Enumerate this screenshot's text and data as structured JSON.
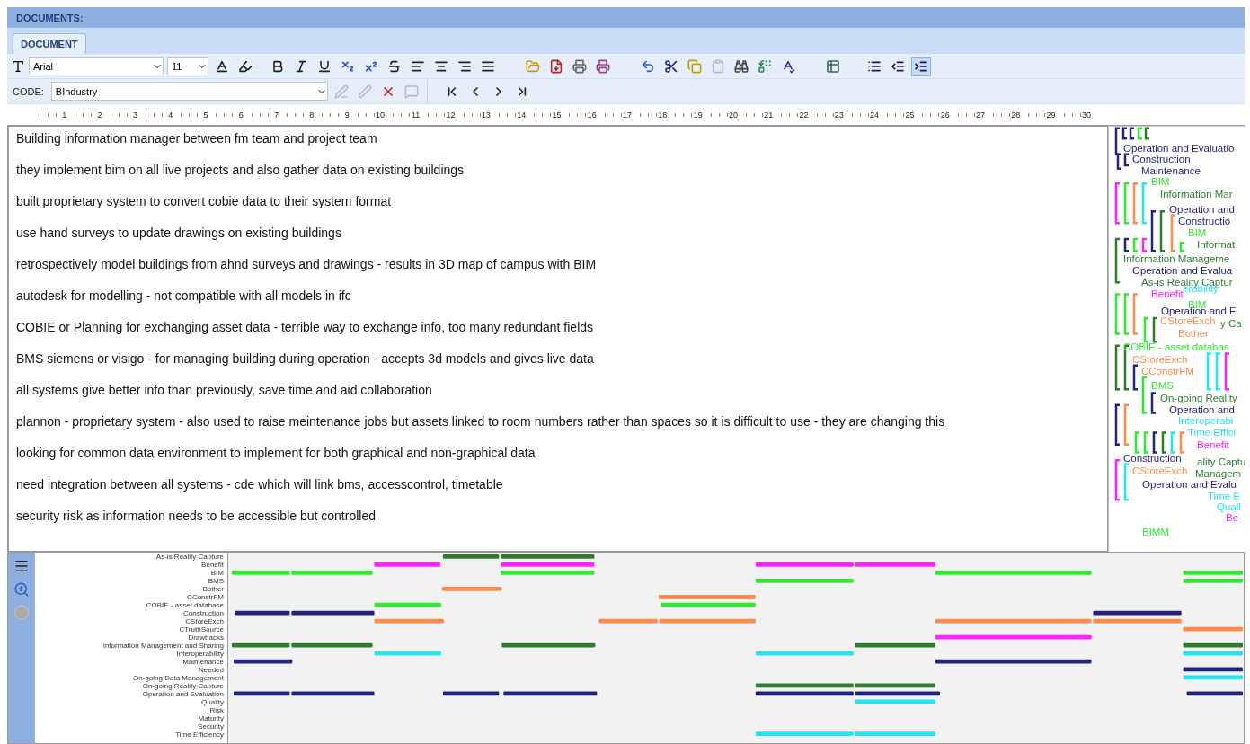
{
  "panel_title": "DOCUMENTS:",
  "tabs": [
    {
      "label": "DOCUMENT",
      "selected": true
    }
  ],
  "font": {
    "family": "Arial",
    "size": "11"
  },
  "code": {
    "label": "CODE:",
    "value": "BIndustry"
  },
  "code_tools": [
    {
      "kind": "apply",
      "disabled": true
    },
    {
      "kind": "apply_all",
      "disabled": true
    },
    {
      "kind": "remove",
      "disabled": false
    },
    {
      "kind": "memo",
      "disabled": true
    }
  ],
  "list_buttons": [
    {
      "kind": "bullets",
      "selected": false
    },
    {
      "kind": "outdent",
      "selected": false
    },
    {
      "kind": "indent",
      "selected": true
    }
  ],
  "ruler": [
    "1",
    "2",
    "3",
    "4",
    "5",
    "6",
    "7",
    "8",
    "9",
    "10",
    "11",
    "12",
    "13",
    "14",
    "15",
    "16",
    "17",
    "18",
    "19",
    "20",
    "21",
    "22",
    "23",
    "24",
    "25",
    "26",
    "27",
    "28",
    "29",
    "30"
  ],
  "paragraphs": [
    "Building information manager between fm team and project team",
    "they implement bim on all live projects and also gather data on existing buildings",
    "built proprietary system to convert cobie data to their system format",
    "use hand surveys to update drawings on existing buildings",
    "retrospectively model buildings from ahnd surveys and drawings - results in 3D map of campus with BIM",
    "autodesk for modelling - not compatible with all models in ifc",
    "COBIE or Planning for exchanging asset data - terrible way to exchange info, too many redundant fields",
    "BMS siemens or visigo - for managing building during operation - accepts 3d models and gives live data",
    "all systems give better info than previously, save time and aid collaboration",
    "plannon - proprietary system - also used to raise meintenance jobs but assets linked to room numbers rather than spaces so it is difficult to use - they are changing this",
    "looking for common data environment to implement for both graphical and non-graphical data",
    "need integration between all systems - cde which will link bms, accesscontrol, timetable",
    "security risk as information needs to be accessible but controlled"
  ],
  "margin_codes": [
    {
      "text": "Operation and Evaluatio",
      "color": "#23237a"
    },
    {
      "text": "Construction",
      "color": "#23237a"
    },
    {
      "text": "Maintenance",
      "color": "#23237a"
    },
    {
      "text": "BIM",
      "color": "#33e833"
    },
    {
      "text": "Information Mar",
      "color": "#2d7d2d"
    },
    {
      "text": "Operation and",
      "color": "#23237a"
    },
    {
      "text": "Constructio",
      "color": "#23237a"
    },
    {
      "text": "BIM",
      "color": "#33e833"
    },
    {
      "text": "Informat",
      "color": "#2d7d2d"
    },
    {
      "text": "Information Manageme",
      "color": "#2d7d2d"
    },
    {
      "text": "Operation and Evalua",
      "color": "#23237a"
    },
    {
      "text": "As-is Reality Captur",
      "color": "#2d7d2d"
    },
    {
      "text": "Benefit",
      "color": "#ff22ff"
    },
    {
      "text": "erability",
      "color": "#22e6ef"
    },
    {
      "text": "BIM",
      "color": "#33e833"
    },
    {
      "text": "Operation and E",
      "color": "#23237a"
    },
    {
      "text": "CStoreExch",
      "color": "#ff8a4a"
    },
    {
      "text": "y Ca",
      "color": "#2d7d2d"
    },
    {
      "text": "Bother",
      "color": "#ff8a4a"
    },
    {
      "text": "COBIE - asset databas",
      "color": "#33e833"
    },
    {
      "text": "CStoreExch",
      "color": "#ff8a4a"
    },
    {
      "text": "CConstrFM",
      "color": "#ff8a4a"
    },
    {
      "text": "BMS",
      "color": "#33e833"
    },
    {
      "text": "On-going Reality",
      "color": "#2d7d2d"
    },
    {
      "text": "Operation and",
      "color": "#23237a"
    },
    {
      "text": "Interoperabi",
      "color": "#22e6ef"
    },
    {
      "text": "Time Effici",
      "color": "#22e6ef"
    },
    {
      "text": "Benefit",
      "color": "#ff22ff"
    },
    {
      "text": "Construction",
      "color": "#23237a"
    },
    {
      "text": "ality Captu",
      "color": "#2d7d2d"
    },
    {
      "text": "CStoreExch",
      "color": "#ff8a4a"
    },
    {
      "text": "Managem",
      "color": "#2d7d2d"
    },
    {
      "text": "Operation and Evalu",
      "color": "#23237a"
    },
    {
      "text": "Time E",
      "color": "#22e6ef"
    },
    {
      "text": "Quali",
      "color": "#22e6ef"
    },
    {
      "text": "Be",
      "color": "#ff22ff"
    },
    {
      "text": "BIMM",
      "color": "#33e833"
    }
  ],
  "timeline": {
    "codes": [
      "As-is Reality Capture",
      "Benefit",
      "BIM",
      "BMS",
      "Bother",
      "CConstrFM",
      "COBIE - asset database",
      "Construction",
      "CStoreExch",
      "CTruthSource",
      "Drawbacks",
      "Information Management and Sharing",
      "Interoperability",
      "Maintenance",
      "Needed",
      "On-going Data Management",
      "On-going Reality Capture",
      "Operation and Evaluation",
      "Quality",
      "Risk",
      "Maturity",
      "Security",
      "Time Efficiency"
    ]
  }
}
